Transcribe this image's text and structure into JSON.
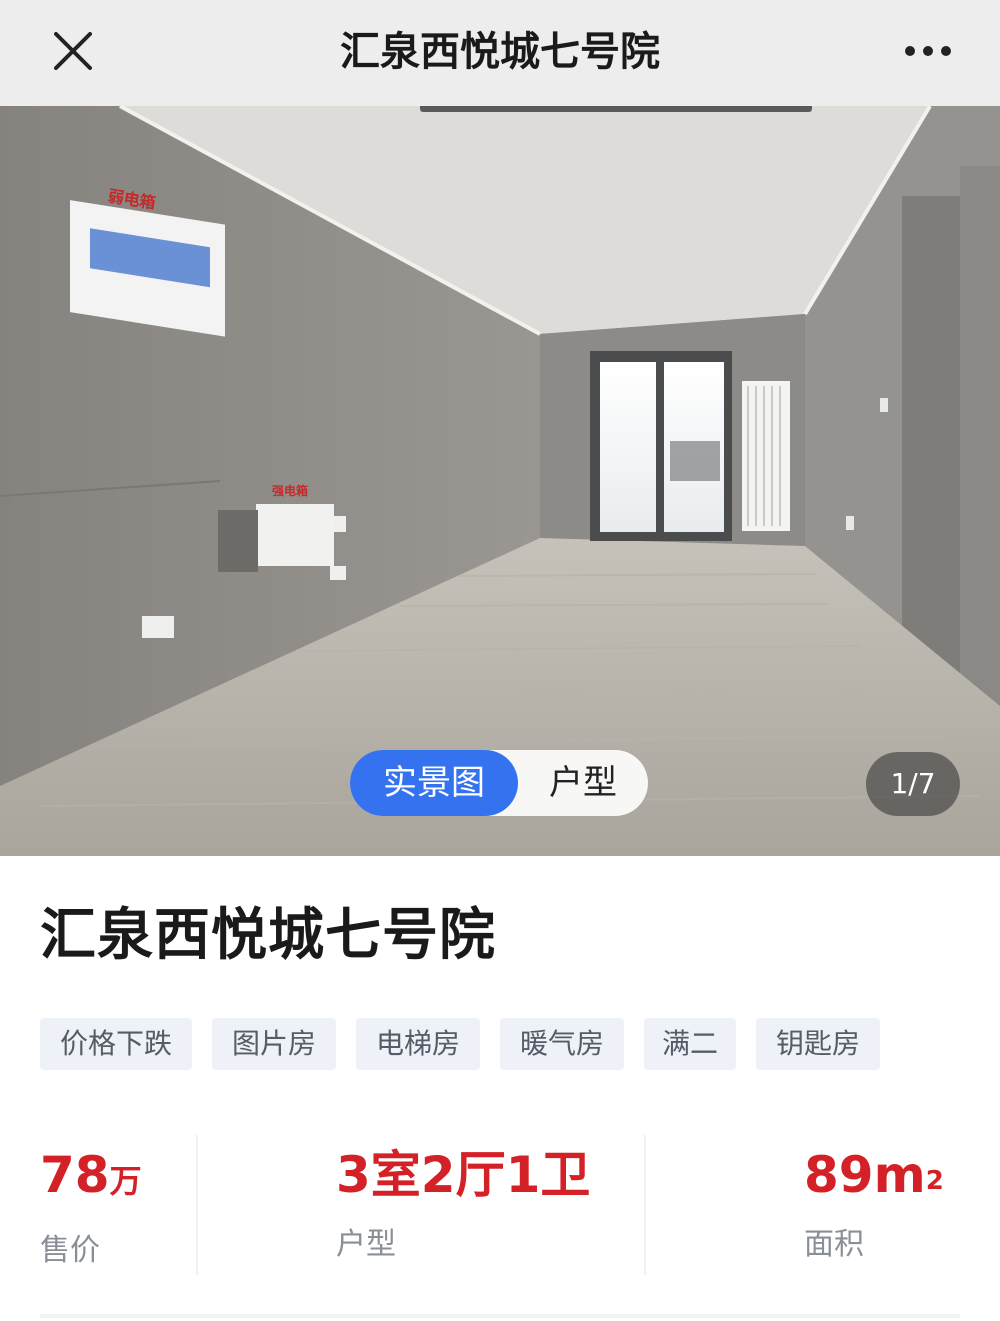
{
  "navbar": {
    "title": "汇泉西悦城七号院",
    "close_icon": "close-icon",
    "more_icon": "more-dots-icon"
  },
  "photo": {
    "tabs": [
      "实景图",
      "户型"
    ],
    "active_tab": "实景图",
    "counter": "1/7",
    "wall_label_1": "弱电箱",
    "wall_label_2": "强电箱"
  },
  "listing": {
    "title": "汇泉西悦城七号院",
    "tags": [
      "价格下跌",
      "图片房",
      "电梯房",
      "暖气房",
      "满二",
      "钥匙房"
    ],
    "stats": [
      {
        "value": "78",
        "unit": "万",
        "label": "售价"
      },
      {
        "value": "3室2厅1卫",
        "unit": "",
        "label": "户型"
      },
      {
        "value": "89m",
        "unit": "2",
        "label": "面积"
      }
    ]
  },
  "colors": {
    "accent_blue": "#3472f0",
    "price_red": "#d42027",
    "tag_bg": "#eef2f8",
    "navbar_bg": "#ededed"
  }
}
